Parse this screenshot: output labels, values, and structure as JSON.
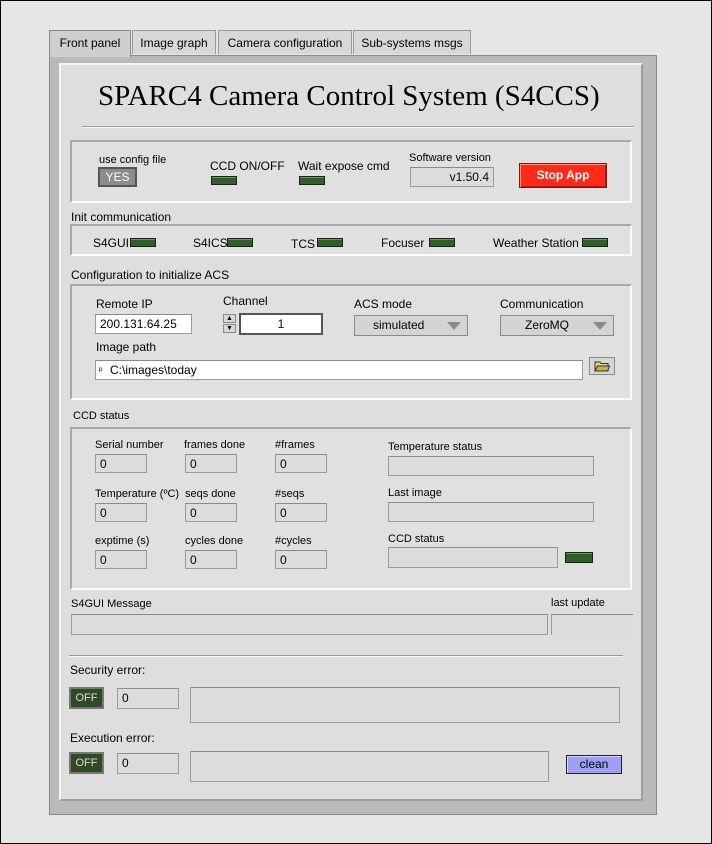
{
  "tabs": [
    "Front panel",
    "Image graph",
    "Camera configuration",
    "Sub-systems msgs"
  ],
  "title": "SPARC4 Camera Control System (S4CCS)",
  "top": {
    "use_config_label": "use config file",
    "use_config_value": "YES",
    "ccd_onoff_label": "CCD ON/OFF",
    "wait_expose_label": "Wait expose cmd",
    "software_version_label": "Software version",
    "software_version_value": "v1.50.4",
    "stop_app_label": "Stop App"
  },
  "init_comm": {
    "title": "Init communication",
    "items": [
      "S4GUI",
      "S4ICS",
      "TCS",
      "Focuser",
      "Weather Station"
    ]
  },
  "acs": {
    "title": "Configuration to initialize ACS",
    "remote_ip_label": "Remote IP",
    "remote_ip_value": "200.131.64.25",
    "channel_label": "Channel",
    "channel_value": "1",
    "acs_mode_label": "ACS mode",
    "acs_mode_value": "simulated",
    "communication_label": "Communication",
    "communication_value": "ZeroMQ",
    "image_path_label": "Image path",
    "image_path_value": "C:\\images\\today"
  },
  "ccd_status": {
    "title": "CCD status",
    "serial_number_label": "Serial number",
    "serial_number_value": "0",
    "frames_done_label": "frames done",
    "frames_done_value": "0",
    "frames_label": "#frames",
    "frames_value": "0",
    "temperature_label": "Temperature (ºC)",
    "temperature_value": "0",
    "seqs_done_label": "seqs done",
    "seqs_done_value": "0",
    "seqs_label": "#seqs",
    "seqs_value": "0",
    "exptime_label": "exptime (s)",
    "exptime_value": "0",
    "cycles_done_label": "cycles done",
    "cycles_done_value": "0",
    "cycles_label": "#cycles",
    "cycles_value": "0",
    "temperature_status_label": "Temperature status",
    "last_image_label": "Last image",
    "ccd_status_label": "CCD status"
  },
  "messages": {
    "s4gui_message_label": "S4GUI Message",
    "last_update_label": "last update"
  },
  "errors": {
    "security_label": "Security error:",
    "security_toggle": "OFF",
    "security_code": "0",
    "execution_label": "Execution error:",
    "execution_toggle": "OFF",
    "execution_code": "0",
    "clean_label": "clean"
  },
  "colors": {
    "stop_button": "#ff2a1a",
    "clean_button": "#9f9ff5",
    "led_off": "#2f5e2a"
  }
}
